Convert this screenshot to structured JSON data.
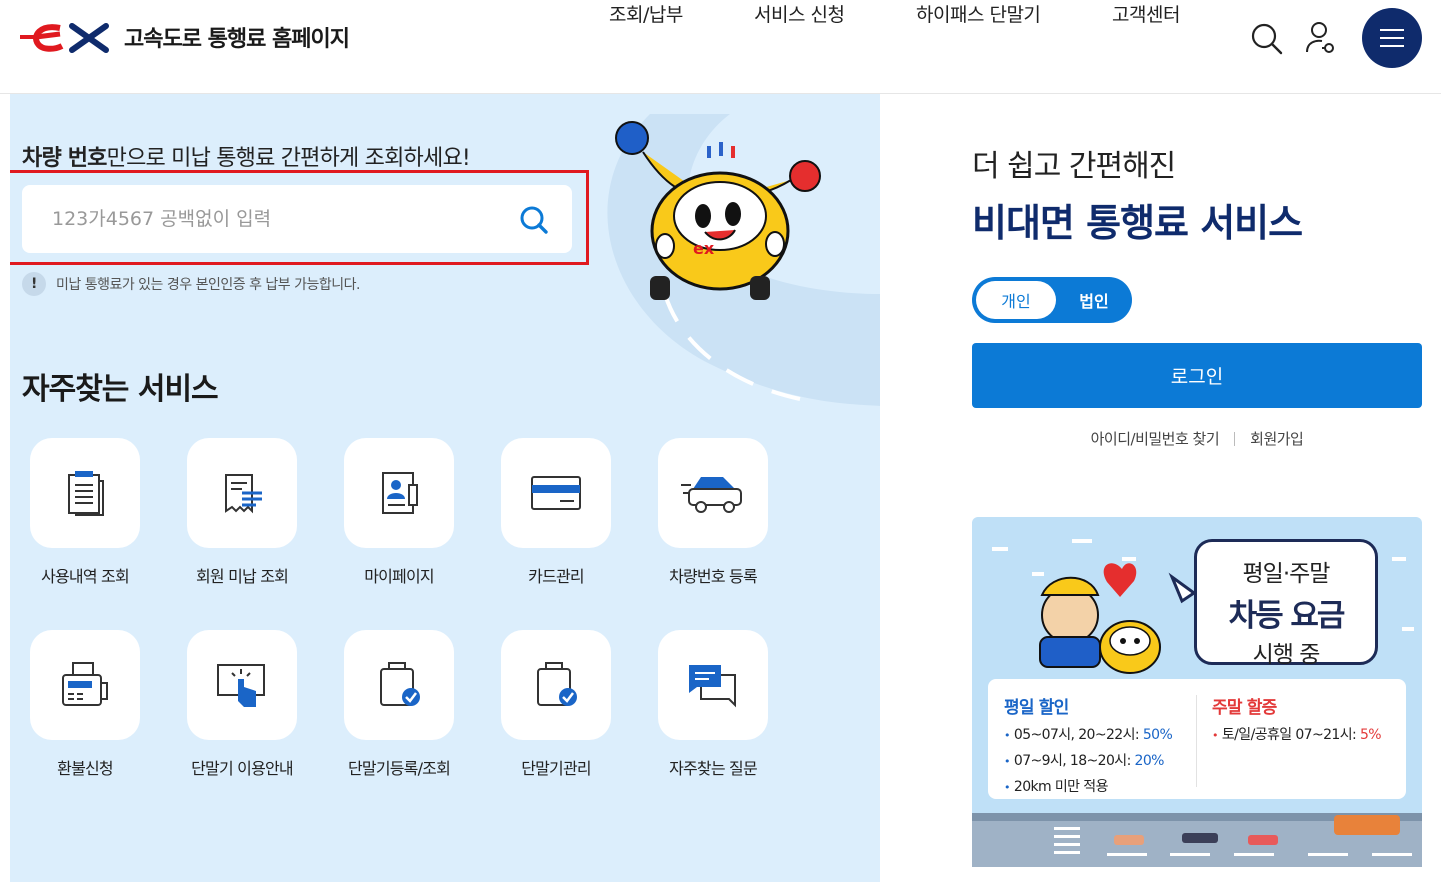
{
  "header": {
    "site_title": "고속도로 통행료 홈페이지",
    "nav": [
      "조회/납부",
      "서비스 신청",
      "하이패스 단말기",
      "고객센터"
    ]
  },
  "search": {
    "title_bold": "차량 번호",
    "title_rest": "만으로 미납 통행료 간편하게 조회하세요!",
    "placeholder": "123가4567 공백없이 입력",
    "value": "",
    "notice_icon": "!",
    "notice": "미납 통행료가 있는 경우 본인인증 후 납부 가능합니다."
  },
  "services": {
    "title": "자주찾는 서비스",
    "items": [
      {
        "label": "사용내역 조회",
        "icon": "usage-history-icon"
      },
      {
        "label": "회원 미납 조회",
        "icon": "receipt-icon"
      },
      {
        "label": "마이페이지",
        "icon": "profile-document-icon"
      },
      {
        "label": "카드관리",
        "icon": "card-icon"
      },
      {
        "label": "차량번호 등록",
        "icon": "car-icon"
      },
      {
        "label": "환불신청",
        "icon": "refund-machine-icon"
      },
      {
        "label": "단말기 이용안내",
        "icon": "touch-screen-icon"
      },
      {
        "label": "단말기등록/조회",
        "icon": "device-check-icon"
      },
      {
        "label": "단말기관리",
        "icon": "device-manage-icon"
      },
      {
        "label": "자주찾는 질문",
        "icon": "faq-chat-icon"
      }
    ]
  },
  "account": {
    "subtitle": "더 쉽고 간편해진",
    "title": "비대면 통행료 서비스",
    "toggle_personal": "개인",
    "toggle_corporate": "법인",
    "login": "로그인",
    "find_id": "아이디/비밀번호 찾기",
    "signup": "회원가입"
  },
  "banner": {
    "bubble_line1": "평일·주말",
    "bubble_line2": "차등 요금",
    "bubble_line3": "시행 중",
    "weekday_title": "평일 할인",
    "weekday_lines": [
      {
        "text": "05~07시, 20~22시: ",
        "pct": "50%"
      },
      {
        "text": "07~9시, 18~20시: ",
        "pct": "20%"
      },
      {
        "text": "20km 미만 적용",
        "pct": ""
      }
    ],
    "weekend_title": "주말 할증",
    "weekend_line": {
      "text": "토/일/공휴일 07~21시: ",
      "pct": "5%"
    }
  },
  "colors": {
    "brand_navy": "#0f2b6c",
    "accent_blue": "#0c7ad6",
    "highlight_red": "#e0191f",
    "panel_bg": "#dceefc"
  }
}
